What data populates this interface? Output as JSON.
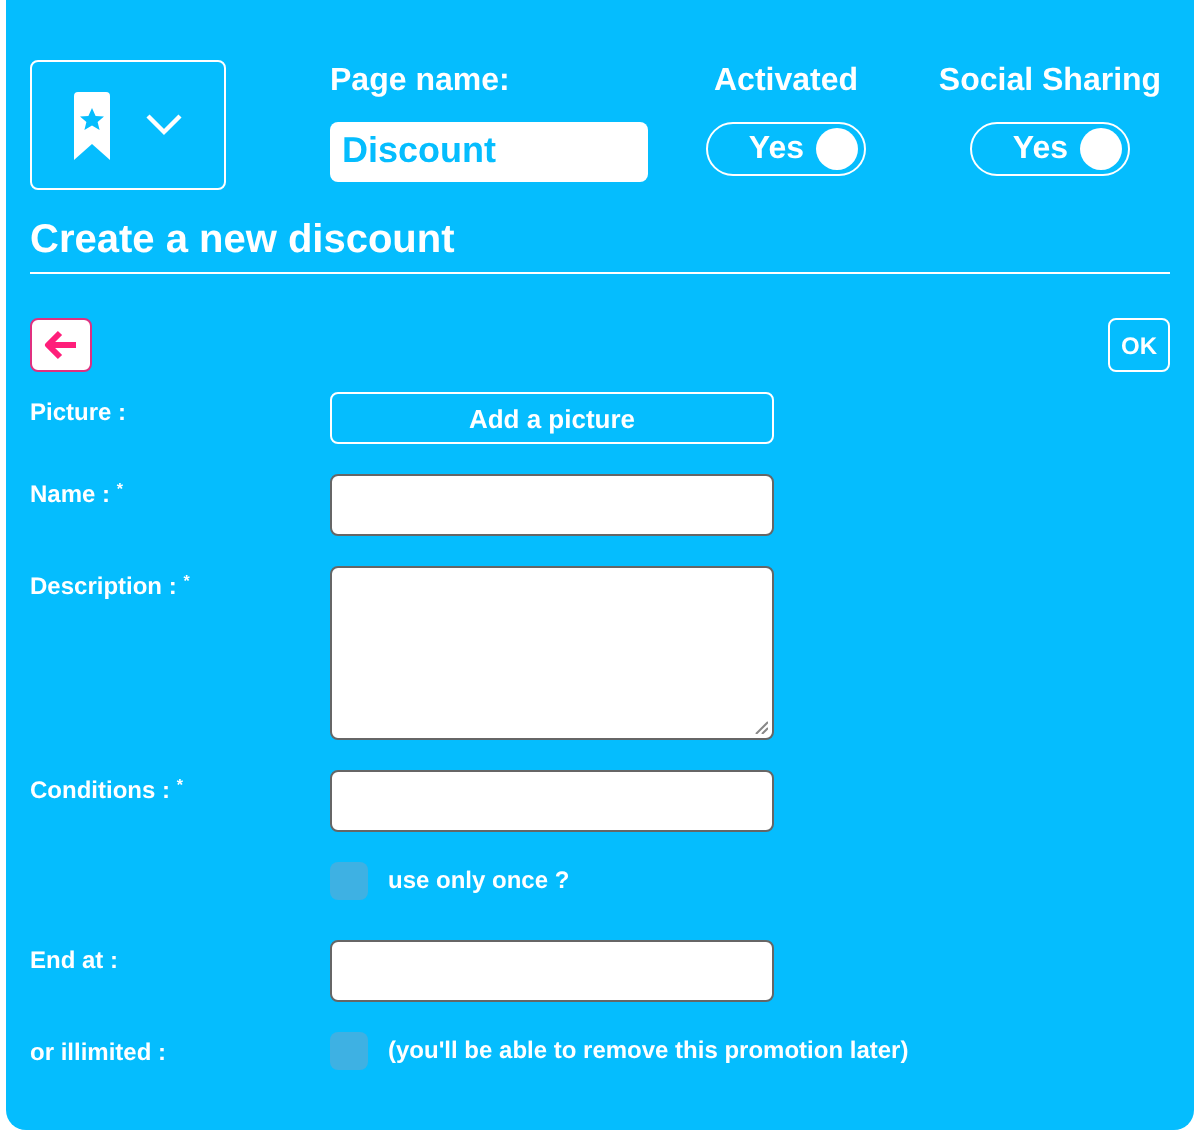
{
  "header": {
    "page_name": {
      "label": "Page name:",
      "value": "Discount"
    },
    "toggles": [
      {
        "label": "Activated",
        "value": "Yes",
        "on": true
      },
      {
        "label": "Social Sharing",
        "value": "Yes",
        "on": true
      }
    ]
  },
  "title": "Create a new discount",
  "toolbar": {
    "ok": "OK"
  },
  "form": [
    {
      "kind": "button",
      "label": "Picture :",
      "button": "Add a picture"
    },
    {
      "kind": "input",
      "label": "Name : $^{*}$"
    },
    {
      "kind": "textarea",
      "label": "Description : $^{*}$"
    },
    {
      "kind": "input",
      "label": "Conditions : $^{*}$"
    },
    {
      "kind": "checkbox",
      "text": "use only once ?",
      "checked": false
    },
    {
      "kind": "input",
      "label": "End at :"
    },
    {
      "kind": "checkbox",
      "label": "or illimited :",
      "text": "(you'll be able to remove this promotion later)",
      "checked": false
    }
  ]
}
